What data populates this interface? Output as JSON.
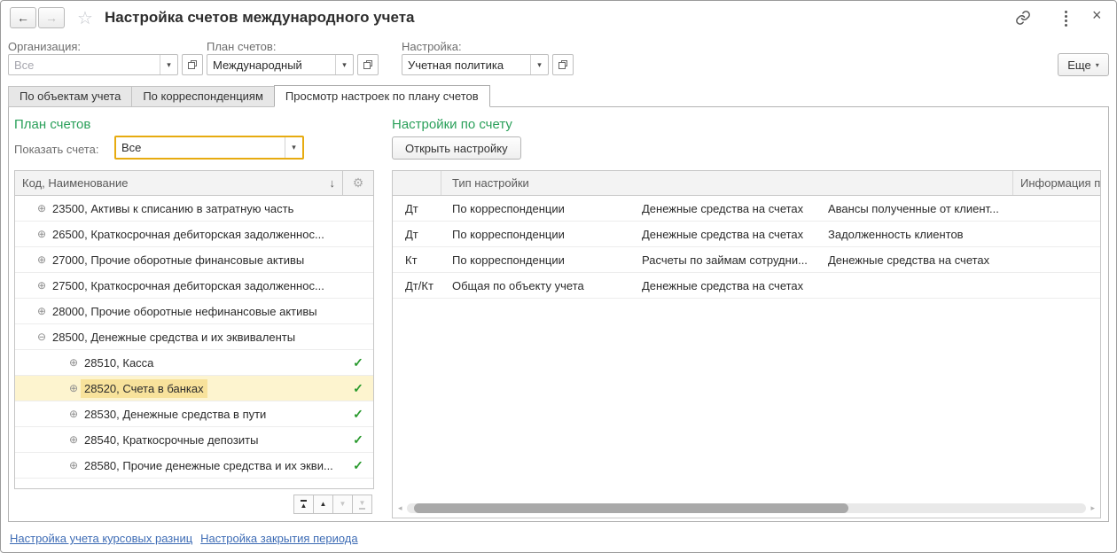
{
  "window": {
    "title": "Настройка счетов международного учета"
  },
  "icons": {
    "back": "←",
    "forward": "→",
    "favorite": "☆",
    "close": "×",
    "dropdown": "▾",
    "sort_desc": "↓",
    "gear": "⚙",
    "scroll_left": "◂",
    "scroll_right": "▸",
    "nav_up": "▲",
    "nav_down": "▼"
  },
  "filters": {
    "organization": {
      "label": "Организация:",
      "value": "Все"
    },
    "chart_of_accounts": {
      "label": "План счетов:",
      "value": "Международный"
    },
    "setting": {
      "label": "Настройка:",
      "value": "Учетная политика"
    },
    "more_button": "Еще"
  },
  "tabs": [
    {
      "label": "По объектам учета"
    },
    {
      "label": "По корреспонденциям"
    },
    {
      "label": "Просмотр настроек по плану счетов"
    }
  ],
  "plan_panel": {
    "title": "План счетов",
    "show_label": "Показать счета:",
    "show_value": "Все",
    "column_header": "Код, Наименование",
    "rows": [
      {
        "toggle": "⊕",
        "text": "23500, Активы к списанию в затратную часть",
        "check": ""
      },
      {
        "toggle": "⊕",
        "text": "26500, Краткосрочная дебиторская задолженнос...",
        "check": ""
      },
      {
        "toggle": "⊕",
        "text": "27000, Прочие оборотные финансовые активы",
        "check": ""
      },
      {
        "toggle": "⊕",
        "text": "27500, Краткосрочная дебиторская задолженнос...",
        "check": ""
      },
      {
        "toggle": "⊕",
        "text": "28000, Прочие оборотные нефинансовые активы",
        "check": ""
      },
      {
        "toggle": "⊖",
        "text": "28500, Денежные средства и их эквиваленты",
        "check": ""
      },
      {
        "toggle": "⊕",
        "text": "28510, Касса",
        "check": "✓"
      },
      {
        "toggle": "⊕",
        "text": "28520, Счета в банках",
        "check": "✓"
      },
      {
        "toggle": "⊕",
        "text": "28530, Денежные средства в пути",
        "check": "✓"
      },
      {
        "toggle": "⊕",
        "text": "28540, Краткосрочные депозиты",
        "check": "✓"
      },
      {
        "toggle": "⊕",
        "text": "28580, Прочие денежные средства и их экви...",
        "check": "✓"
      }
    ]
  },
  "settings_panel": {
    "title": "Настройки по счету",
    "open_button": "Открыть настройку",
    "col_type": "Тип настройки",
    "col_info": "Информация по",
    "rows": [
      {
        "side": "Дт",
        "type": "По корреспонденции",
        "object": "Денежные средства на счетах",
        "info": "Авансы полученные от клиент...",
        "extra": ""
      },
      {
        "side": "Дт",
        "type": "По корреспонденции",
        "object": "Денежные средства на счетах",
        "info": "Задолженность клиентов",
        "extra": ""
      },
      {
        "side": "Кт",
        "type": "По корреспонденции",
        "object": "Расчеты по займам сотрудни...",
        "info": "Денежные средства на счетах",
        "extra": ""
      },
      {
        "side": "Дт/Кт",
        "type": "Общая по объекту учета",
        "object": "Денежные средства на счетах",
        "info": "",
        "extra": ""
      }
    ]
  },
  "footer": {
    "links": [
      "Настройка учета курсовых разниц",
      "Настройка закрытия периода"
    ]
  }
}
